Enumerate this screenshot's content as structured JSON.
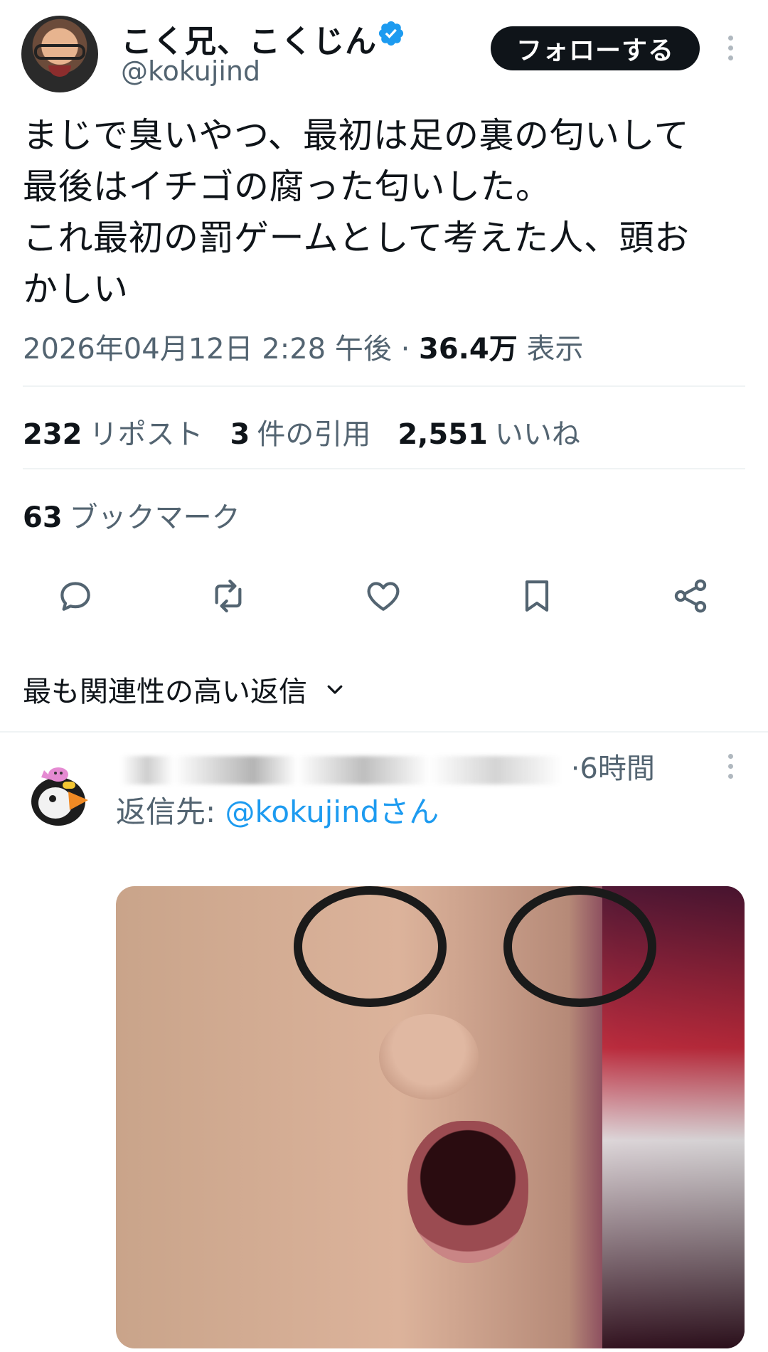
{
  "tweet": {
    "author": {
      "display_name": "こく兄、こくじん",
      "handle": "@kokujind",
      "verified": true
    },
    "follow_label": "フォローする",
    "text": "まじで臭いやつ、最初は足の裏の匂いして\n最後はイチゴの腐った匂いした。\nこれ最初の罰ゲームとして考えた人、頭お\nかしい",
    "timestamp": "2026年04月12日 2:28 午後",
    "separator": "·",
    "views_count": "36.4万",
    "views_label": "表示",
    "stats": {
      "reposts_count": "232",
      "reposts_label": "リポスト",
      "quotes_count": "3",
      "quotes_label": "件の引用",
      "likes_count": "2,551",
      "likes_label": "いいね",
      "bookmarks_count": "63",
      "bookmarks_label": "ブックマーク"
    },
    "actions": [
      "reply-icon",
      "repost-icon",
      "like-icon",
      "bookmark-icon",
      "share-icon"
    ]
  },
  "replies_sort": {
    "label": "最も関連性の高い返信"
  },
  "reply": {
    "time_suffix": "·6時間",
    "reply_to_prefix": "返信先: ",
    "reply_to_mention": "@kokujindさん"
  },
  "colors": {
    "text": "#0f1419",
    "secondary": "#536471",
    "accent": "#1d9bf0",
    "divider": "#eff3f4"
  }
}
